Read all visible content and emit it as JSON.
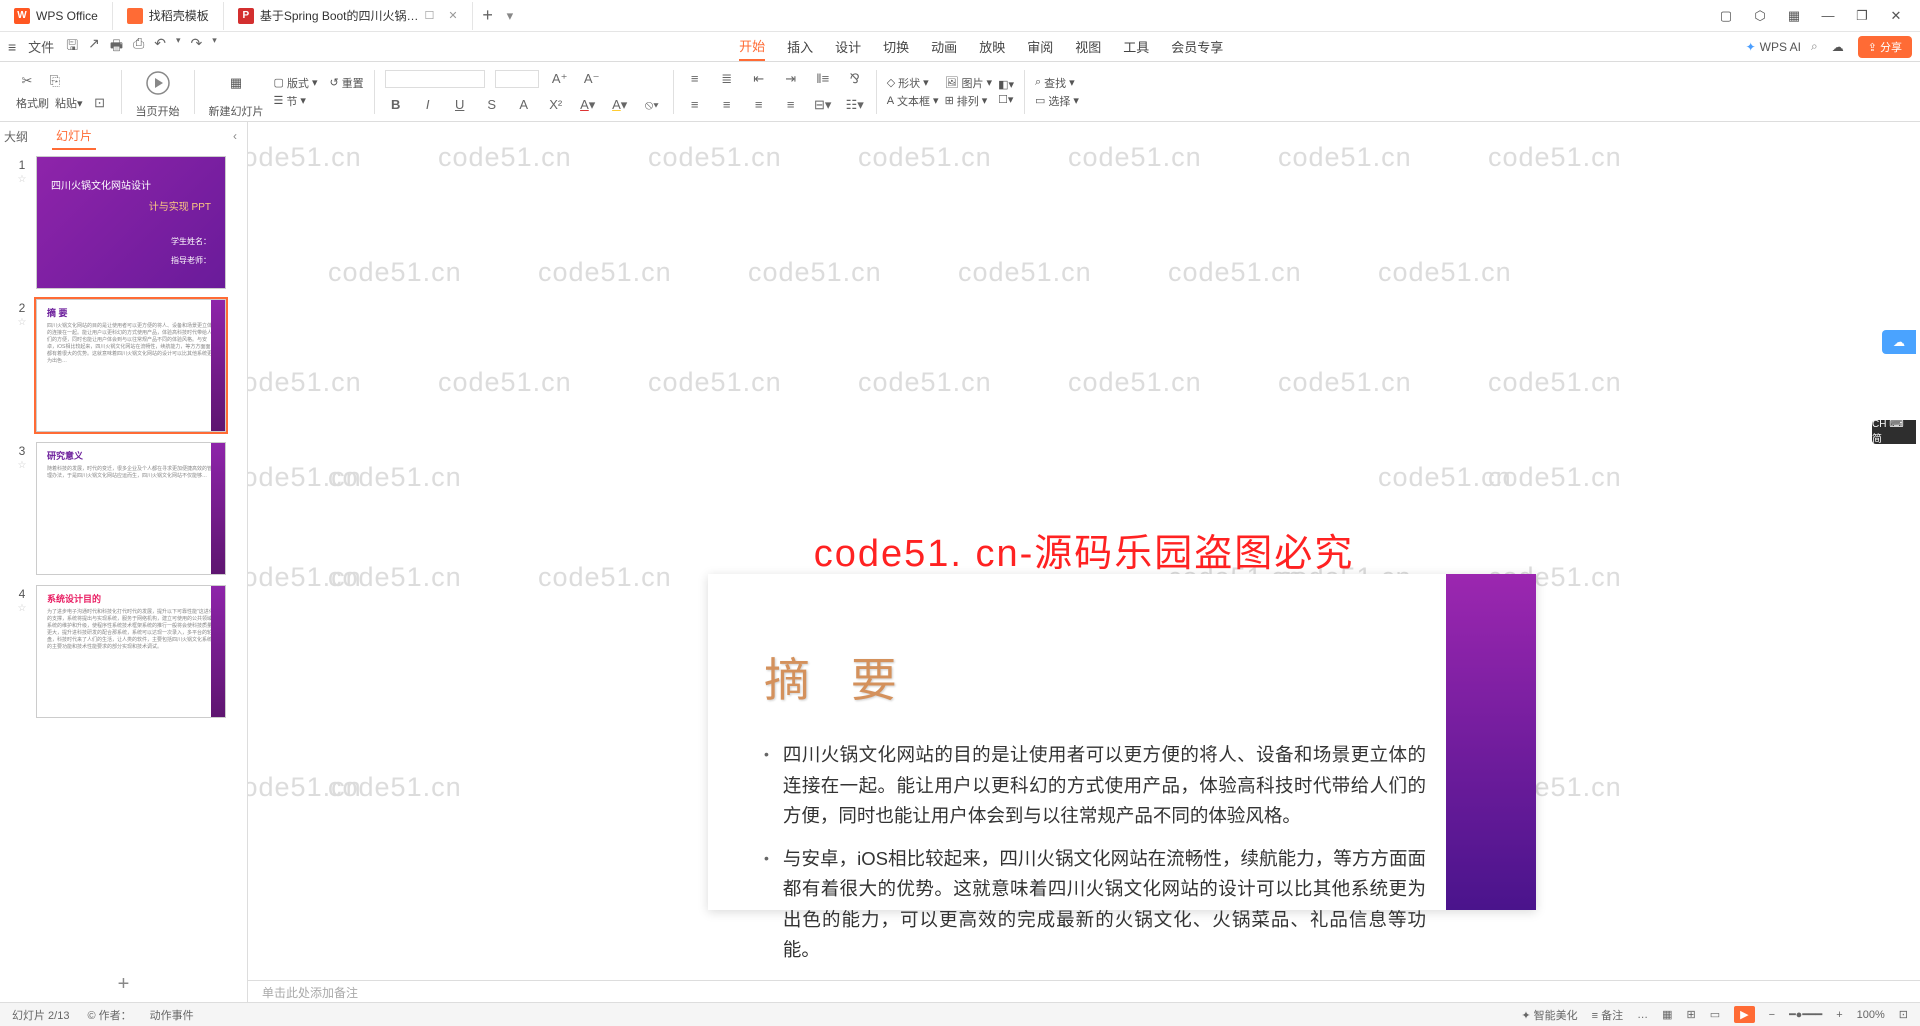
{
  "titlebar": {
    "tabs": [
      {
        "label": "WPS Office",
        "icon": "wps"
      },
      {
        "label": "找稻壳模板",
        "icon": "doc"
      },
      {
        "label": "基于Spring Boot的四川火锅…",
        "icon": "p",
        "active": true
      }
    ],
    "plus": "+"
  },
  "menubar": {
    "file": "文件",
    "main_tabs": [
      "开始",
      "插入",
      "设计",
      "切换",
      "动画",
      "放映",
      "审阅",
      "视图",
      "工具",
      "会员专享"
    ],
    "active_main_tab": 0,
    "wps_ai": "WPS AI",
    "share": "分享"
  },
  "ribbon": {
    "g1": {
      "brush": "格式刷",
      "paste": "粘贴"
    },
    "g2": {
      "play": "当页开始"
    },
    "g3": {
      "new": "新建幻灯片",
      "layout": "版式",
      "section": "节",
      "reset": "重置"
    },
    "font_style_icons": [
      "B",
      "I",
      "U",
      "S",
      "A",
      "A",
      "A",
      "A",
      "A"
    ],
    "align_icons": 10,
    "g_shape": {
      "shape": "形状",
      "pic": "图片",
      "arrange": "排列"
    },
    "g_text": {
      "text": "文本框"
    },
    "g_find": {
      "find": "查找",
      "select": "选择"
    }
  },
  "sidebar": {
    "tabs": [
      "大纲",
      "幻灯片"
    ],
    "active": 1,
    "slides": [
      {
        "n": "1",
        "type": "title",
        "title": "四川火锅文化网站设计",
        "sub1": "学生姓名：",
        "sub2": "指导老师："
      },
      {
        "n": "2",
        "type": "content",
        "heading": "摘  要",
        "sel": true
      },
      {
        "n": "3",
        "type": "content",
        "heading": "研究意义"
      },
      {
        "n": "4",
        "type": "content",
        "heading": "系统设计目的",
        "pink": true
      }
    ],
    "add": "+"
  },
  "canvas": {
    "watermark": "code51.cn",
    "banner": "code51. cn-源码乐园盗图必究",
    "slide_title": "摘  要",
    "bullets": [
      "四川火锅文化网站的目的是让使用者可以更方便的将人、设备和场景更立体的连接在一起。能让用户以更科幻的方式使用产品，体验高科技时代带给人们的方便，同时也能让用户体会到与以往常规产品不同的体验风格。",
      "与安卓，iOS相比较起来，四川火锅文化网站在流畅性，续航能力，等方方面面都有着很大的优势。这就意味着四川火锅文化网站的设计可以比其他系统更为出色的能力，可以更高效的完成最新的火锅文化、火锅菜品、礼品信息等功能。"
    ]
  },
  "notes": {
    "placeholder": "单击此处添加备注"
  },
  "status": {
    "left": [
      "幻灯片 2/13",
      "© 作者：",
      "动作事件"
    ],
    "right": [
      "智能美化",
      "备注",
      "…",
      "100%"
    ]
  },
  "float": {
    "ch": "CH ⌨ 简"
  }
}
